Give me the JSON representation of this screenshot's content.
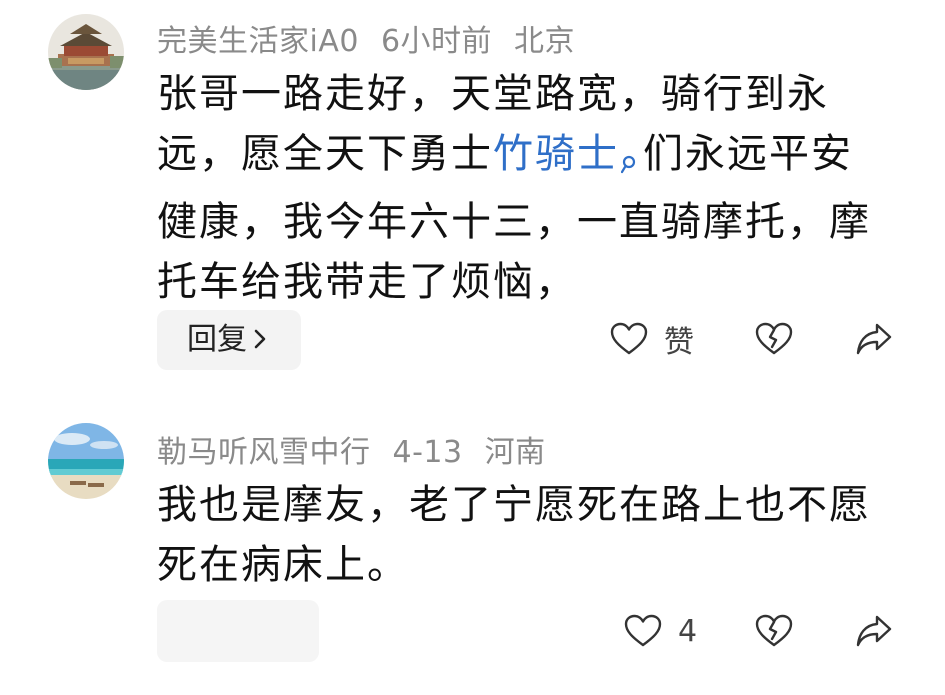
{
  "comments": [
    {
      "author": "完美生活家iA0",
      "time": "6小时前",
      "location": "北京",
      "avatar_icon": "palace-tower-avatar",
      "text_before_link": "张哥一路走好，天堂路宽，骑行到永远，愿全天下勇士",
      "link_text": "竹骑士",
      "text_after_link": "们永远平安健康，我今年六十三，一直骑摩托，摩托车给我带走了烦恼，",
      "reply_label": "回复",
      "like_label": "赞"
    },
    {
      "author": "勒马听风雪中行",
      "time": "4-13",
      "location": "河南",
      "avatar_icon": "beach-avatar",
      "text": "我也是摩友，老了宁愿死在路上也不愿死在病床上。",
      "reply_label": "",
      "like_count": "4"
    }
  ],
  "colors": {
    "link": "#2f6fc8",
    "meta": "#8a8a8a",
    "reply_bg": "#f3f3f3"
  }
}
